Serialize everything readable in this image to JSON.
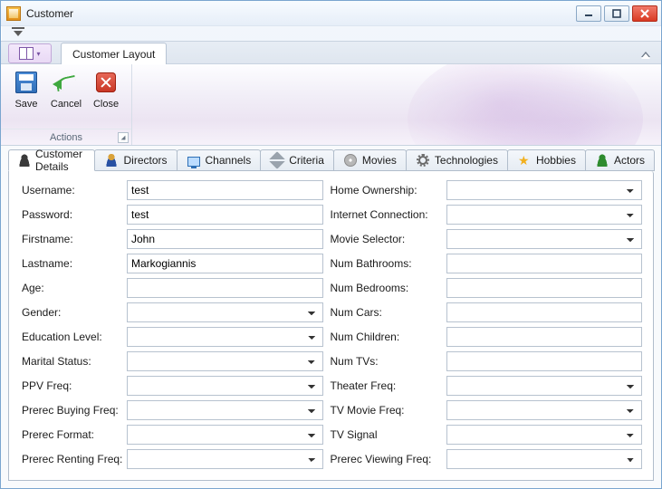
{
  "window": {
    "title": "Customer"
  },
  "ribbon": {
    "tab": "Customer Layout",
    "group_caption": "Actions",
    "items": {
      "save": "Save",
      "cancel": "Cancel",
      "close": "Close"
    }
  },
  "tabs": [
    {
      "label": "Customer Details",
      "icon": "person"
    },
    {
      "label": "Directors",
      "icon": "director"
    },
    {
      "label": "Channels",
      "icon": "tv"
    },
    {
      "label": "Criteria",
      "icon": "wrench"
    },
    {
      "label": "Movies",
      "icon": "dvd"
    },
    {
      "label": "Technologies",
      "icon": "gear"
    },
    {
      "label": "Hobbies",
      "icon": "star"
    },
    {
      "label": "Actors",
      "icon": "person-green"
    }
  ],
  "fields": {
    "left": [
      {
        "label": "Username:",
        "type": "text",
        "value": "test"
      },
      {
        "label": "Password:",
        "type": "text",
        "value": "test"
      },
      {
        "label": "Firstname:",
        "type": "text",
        "value": "John"
      },
      {
        "label": "Lastname:",
        "type": "text",
        "value": "Markogiannis"
      },
      {
        "label": "Age:",
        "type": "text",
        "value": ""
      },
      {
        "label": "Gender:",
        "type": "select",
        "value": ""
      },
      {
        "label": "Education Level:",
        "type": "select",
        "value": ""
      },
      {
        "label": "Marital Status:",
        "type": "select",
        "value": ""
      },
      {
        "label": "PPV Freq:",
        "type": "select",
        "value": ""
      },
      {
        "label": "Prerec Buying Freq:",
        "type": "select",
        "value": ""
      },
      {
        "label": "Prerec Format:",
        "type": "select",
        "value": ""
      },
      {
        "label": "Prerec Renting Freq:",
        "type": "select",
        "value": ""
      }
    ],
    "right": [
      {
        "label": "Home Ownership:",
        "type": "select",
        "value": ""
      },
      {
        "label": "Internet Connection:",
        "type": "select",
        "value": ""
      },
      {
        "label": "Movie Selector:",
        "type": "select",
        "value": ""
      },
      {
        "label": "Num Bathrooms:",
        "type": "text",
        "value": ""
      },
      {
        "label": "Num Bedrooms:",
        "type": "text",
        "value": ""
      },
      {
        "label": "Num Cars:",
        "type": "text",
        "value": ""
      },
      {
        "label": "Num Children:",
        "type": "text",
        "value": ""
      },
      {
        "label": "Num TVs:",
        "type": "text",
        "value": ""
      },
      {
        "label": "Theater Freq:",
        "type": "select",
        "value": ""
      },
      {
        "label": "TV Movie Freq:",
        "type": "select",
        "value": ""
      },
      {
        "label": "TV Signal",
        "type": "select",
        "value": ""
      },
      {
        "label": "Prerec Viewing Freq:",
        "type": "select",
        "value": ""
      }
    ]
  }
}
